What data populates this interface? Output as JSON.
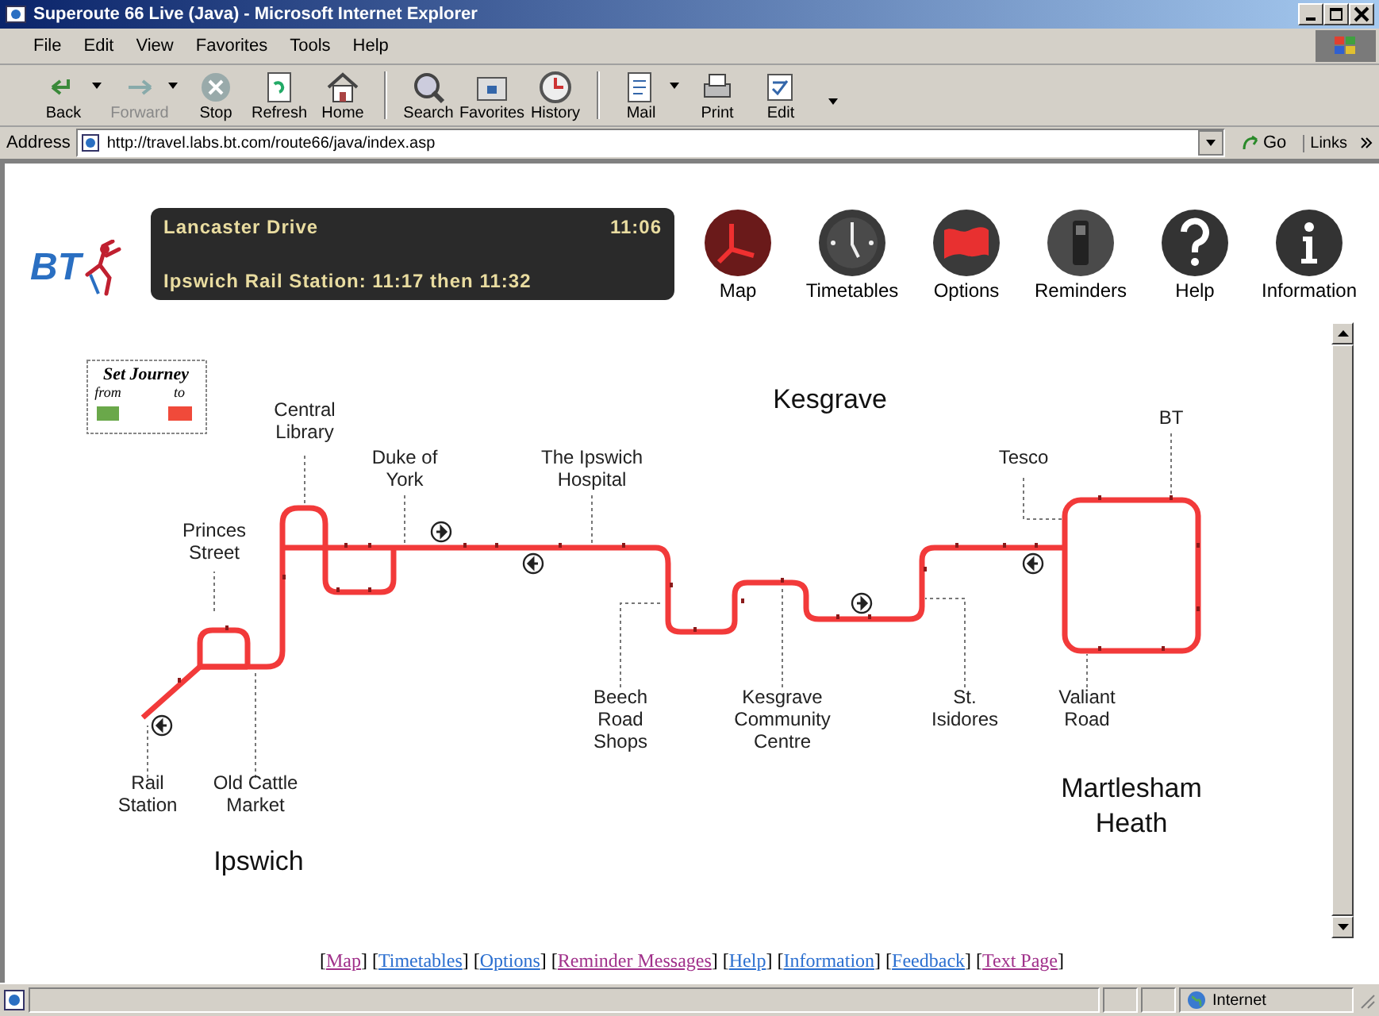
{
  "window": {
    "title": "Superoute 66 Live (Java) - Microsoft Internet Explorer"
  },
  "menu": [
    "File",
    "Edit",
    "View",
    "Favorites",
    "Tools",
    "Help"
  ],
  "toolbar": [
    {
      "label": "Back",
      "kind": "back",
      "disabled": false,
      "dropdown": true
    },
    {
      "label": "Forward",
      "kind": "forward",
      "disabled": true,
      "dropdown": true
    },
    {
      "label": "Stop",
      "kind": "stop",
      "disabled": false,
      "dropdown": false
    },
    {
      "label": "Refresh",
      "kind": "refresh",
      "disabled": false,
      "dropdown": false
    },
    {
      "label": "Home",
      "kind": "home",
      "disabled": false,
      "dropdown": false
    },
    {
      "label": "Search",
      "kind": "search",
      "disabled": false,
      "dropdown": false
    },
    {
      "label": "Favorites",
      "kind": "favorites",
      "disabled": false,
      "dropdown": false
    },
    {
      "label": "History",
      "kind": "history",
      "disabled": false,
      "dropdown": false
    },
    {
      "label": "Mail",
      "kind": "mail",
      "disabled": false,
      "dropdown": true
    },
    {
      "label": "Print",
      "kind": "print",
      "disabled": false,
      "dropdown": false
    },
    {
      "label": "Edit",
      "kind": "edit",
      "disabled": false,
      "dropdown": false
    }
  ],
  "address": {
    "label": "Address",
    "value": "http://travel.labs.bt.com/route66/java/index.asp",
    "go": "Go",
    "links": "Links"
  },
  "logo": {
    "text": "BT"
  },
  "banner": {
    "stop": "Lancaster Drive",
    "time": "11:06",
    "next": "Ipswich Rail Station: 11:17 then 11:32"
  },
  "nav": [
    {
      "label": "Map",
      "kind": "map"
    },
    {
      "label": "Timetables",
      "kind": "timetables"
    },
    {
      "label": "Options",
      "kind": "options"
    },
    {
      "label": "Reminders",
      "kind": "reminders"
    },
    {
      "label": "Help",
      "kind": "help"
    },
    {
      "label": "Information",
      "kind": "information"
    }
  ],
  "set_journey": {
    "title": "Set Journey",
    "from": "from",
    "to": "to"
  },
  "areas": [
    "Kesgrave",
    "Martlesham Heath",
    "Ipswich"
  ],
  "stops": [
    "Central Library",
    "BT",
    "Duke of York",
    "The Ipswich Hospital",
    "Tesco",
    "Princes Street",
    "Beech Road Shops",
    "Kesgrave Community Centre",
    "St. Isidores",
    "Valiant Road",
    "Rail Station",
    "Old Cattle Market"
  ],
  "footer_links": [
    {
      "before": "[",
      "label": "Map",
      "after": "]",
      "visited": true
    },
    {
      "before": "[",
      "label": "Timetables",
      "after": "]",
      "visited": false
    },
    {
      "before": "[",
      "label": "Options",
      "after": "]",
      "visited": false
    },
    {
      "before": "[",
      "label": "Reminder Messages",
      "after": "]",
      "visited": true
    },
    {
      "before": "[",
      "label": "Help",
      "after": "]",
      "visited": false
    },
    {
      "before": "[",
      "label": "Information",
      "after": "]",
      "visited": false
    },
    {
      "before": "[",
      "label": "Feedback",
      "after": "]",
      "visited": false
    },
    {
      "before": "[",
      "label": "Text Page",
      "after": "]",
      "visited": true
    }
  ],
  "status_bar": {
    "zone": "Internet"
  }
}
